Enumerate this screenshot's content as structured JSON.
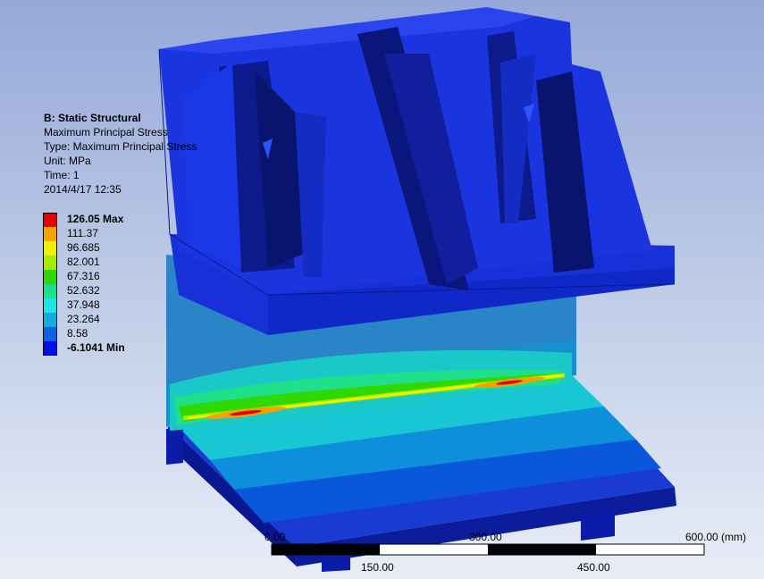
{
  "info": {
    "title": "B: Static Structural",
    "result": "Maximum Principal Stress",
    "type": "Type: Maximum Principal Stress",
    "unit": "Unit: MPa",
    "time": "Time: 1",
    "date": "2014/4/17 12:35"
  },
  "legend": [
    {
      "label": "126.05 Max",
      "color": "#e60000",
      "bold": true
    },
    {
      "label": "111.37",
      "color": "#f5a200",
      "bold": false
    },
    {
      "label": "96.685",
      "color": "#f0f000",
      "bold": false
    },
    {
      "label": "82.001",
      "color": "#a8ea00",
      "bold": false
    },
    {
      "label": "67.316",
      "color": "#2ed800",
      "bold": false
    },
    {
      "label": "52.632",
      "color": "#1ee08a",
      "bold": false
    },
    {
      "label": "37.948",
      "color": "#19e6e6",
      "bold": false
    },
    {
      "label": "23.264",
      "color": "#10aede",
      "bold": false
    },
    {
      "label": "8.58",
      "color": "#0a64e0",
      "bold": false
    },
    {
      "label": "-6.1041 Min",
      "color": "#0010e6",
      "bold": true
    }
  ],
  "scale": {
    "top_labels": [
      "0.00",
      "300.00",
      "600.00 (mm)"
    ],
    "bottom_labels": [
      "150.00",
      "450.00"
    ]
  }
}
